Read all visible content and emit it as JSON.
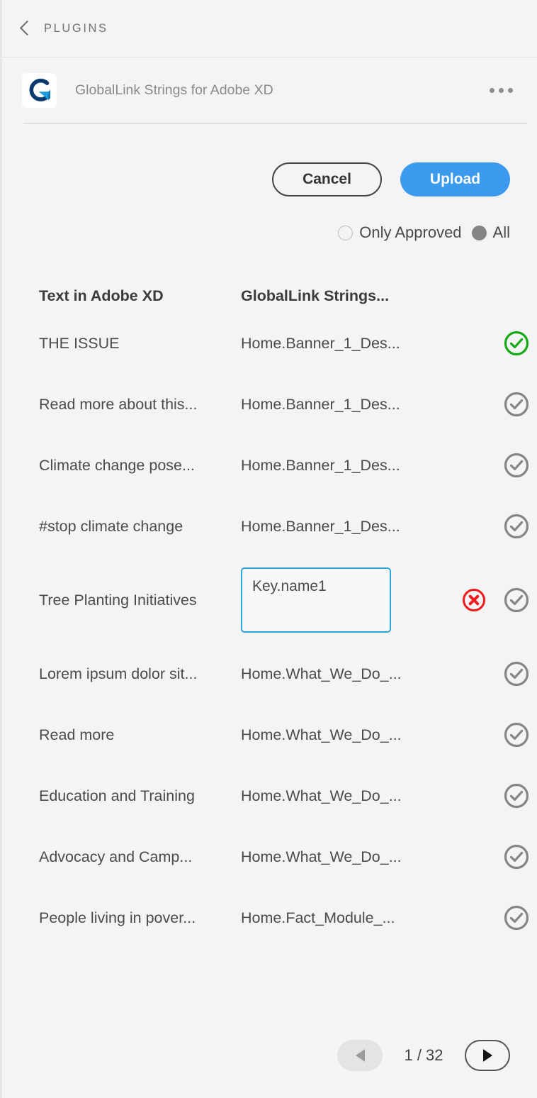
{
  "topbar": {
    "back_label": "PLUGINS",
    "back_icon": "chevron-left-icon"
  },
  "plugin": {
    "title": "GlobalLink Strings for Adobe XD",
    "logo_icon": "globallink-logo-icon",
    "menu_icon": "kebab-menu-icon",
    "logo_colors": {
      "navy": "#0b3a6f",
      "blue": "#1a9bdc"
    }
  },
  "actions": {
    "cancel_label": "Cancel",
    "upload_label": "Upload",
    "upload_bg": "#3b9aee"
  },
  "filter": {
    "options": [
      {
        "label": "Only Approved",
        "selected": false
      },
      {
        "label": "All",
        "selected": true
      }
    ]
  },
  "table": {
    "headers": {
      "col_source": "Text in Adobe XD",
      "col_target": "GlobalLink Strings..."
    },
    "rows": [
      {
        "source": "THE ISSUE",
        "target": "Home.Banner_1_Des...",
        "status": "approved",
        "status_icon": "check-circle-icon",
        "status_color": "#16a916",
        "editing": false,
        "error": false
      },
      {
        "source": "Read more about this...",
        "target": "Home.Banner_1_Des...",
        "status": "unapproved",
        "status_icon": "check-circle-icon",
        "status_color": "#858585",
        "editing": false,
        "error": false
      },
      {
        "source": "Climate change pose...",
        "target": "Home.Banner_1_Des...",
        "status": "unapproved",
        "status_icon": "check-circle-icon",
        "status_color": "#858585",
        "editing": false,
        "error": false
      },
      {
        "source": "#stop climate change",
        "target": "Home.Banner_1_Des...",
        "status": "unapproved",
        "status_icon": "check-circle-icon",
        "status_color": "#858585",
        "editing": false,
        "error": false
      },
      {
        "source": "Tree Planting Initiatives",
        "target": "Key.name1",
        "status": "unapproved",
        "status_icon": "check-circle-icon",
        "status_color": "#858585",
        "editing": true,
        "error": true,
        "error_icon": "error-circle-icon",
        "error_color": "#ee1c1c"
      },
      {
        "source": "Lorem ipsum dolor sit...",
        "target": "Home.What_We_Do_...",
        "status": "unapproved",
        "status_icon": "check-circle-icon",
        "status_color": "#858585",
        "editing": false,
        "error": false
      },
      {
        "source": "Read more",
        "target": "Home.What_We_Do_...",
        "status": "unapproved",
        "status_icon": "check-circle-icon",
        "status_color": "#858585",
        "editing": false,
        "error": false
      },
      {
        "source": "Education and Training",
        "target": "Home.What_We_Do_...",
        "status": "unapproved",
        "status_icon": "check-circle-icon",
        "status_color": "#858585",
        "editing": false,
        "error": false
      },
      {
        "source": "Advocacy and Camp...",
        "target": "Home.What_We_Do_...",
        "status": "unapproved",
        "status_icon": "check-circle-icon",
        "status_color": "#858585",
        "editing": false,
        "error": false
      },
      {
        "source": "People living in pover...",
        "target": "Home.Fact_Module_...",
        "status": "unapproved",
        "status_icon": "check-circle-icon",
        "status_color": "#858585",
        "editing": false,
        "error": false
      }
    ]
  },
  "pagination": {
    "prev_icon": "triangle-left-icon",
    "next_icon": "triangle-right-icon",
    "count_label": "1 / 32",
    "prev_disabled": true
  }
}
